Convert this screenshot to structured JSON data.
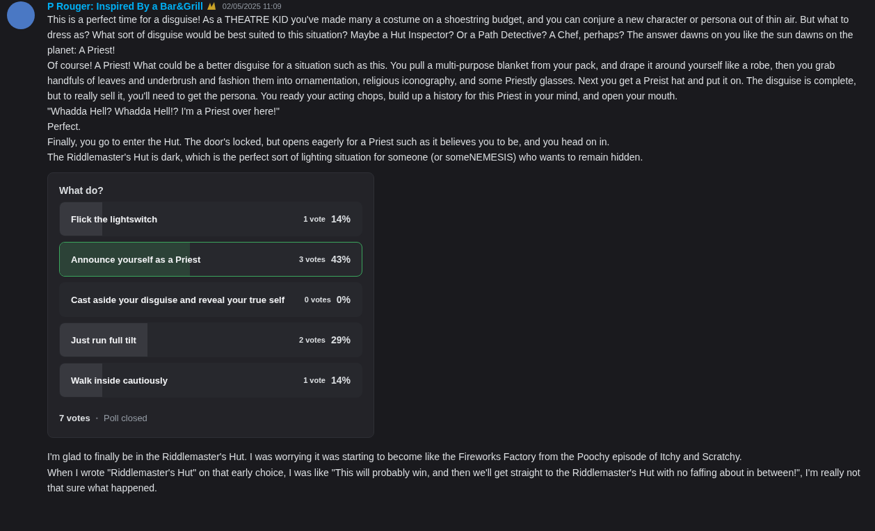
{
  "message": {
    "author": "P Rouger: Inspired By a Bar&Grill",
    "timestamp": "02/05/2025 11:09",
    "paragraphs": [
      "This is a perfect time for a disguise! As a THEATRE KID you've made many a costume on a shoestring budget, and you can conjure a new character or persona out of thin air. But what to dress as? What sort of disguise would be best suited to this situation? Maybe a Hut Inspector? Or a Path Detective? A Chef, perhaps? The answer dawns on you like the sun dawns on the planet: A Priest!",
      "Of course! A Priest! What could be a better disguise for a situation such as this. You pull a multi-purpose blanket from your pack, and drape it around yourself like a robe, then you grab handfuls of leaves and underbrush and fashion them into ornamentation, religious iconography, and some Priestly glasses. Next you get a Preist hat and put it on. The disguise is complete, but to really sell it, you'll need to get the persona. You ready your acting chops, build up a history for this Priest in your mind, and open your mouth.",
      "\"Whadda Hell? Whadda Hell!? I'm a Priest over here!\"",
      "Perfect.",
      "Finally, you go to enter the Hut. The door's locked, but opens eagerly for a Priest such as it believes you to be, and you head on in.",
      "The Riddlemaster's Hut is dark, which is the perfect sort of lighting situation for someone (or someNEMESIS) who wants to remain hidden."
    ]
  },
  "poll": {
    "question": "What do?",
    "options": [
      {
        "label": "Flick the lightswitch",
        "votes": "1 vote",
        "percent": "14%",
        "level": 0.14,
        "selected": false
      },
      {
        "label": "Announce yourself as a Priest",
        "votes": "3 votes",
        "percent": "43%",
        "level": 0.43,
        "selected": true
      },
      {
        "label": "Cast aside your disguise and reveal your true self",
        "votes": "0 votes",
        "percent": "0%",
        "level": 0,
        "selected": false
      },
      {
        "label": "Just run full tilt",
        "votes": "2 votes",
        "percent": "29%",
        "level": 0.29,
        "selected": false
      },
      {
        "label": "Walk inside cautiously",
        "votes": "1 vote",
        "percent": "14%",
        "level": 0.14,
        "selected": false
      }
    ],
    "total": "7 votes",
    "separator": "•",
    "status": "Poll closed"
  },
  "followups": [
    "I'm glad to finally be in the Riddlemaster's Hut. I was worrying it was starting to become like the Fireworks Factory from the Poochy episode of Itchy and Scratchy.",
    "When I wrote \"Riddlemaster's Hut\" on that early choice, I was like \"This will probably win, and then we'll get straight to the Riddlemaster's Hut with no faffing about in between!\", I'm really not that sure what happened."
  ]
}
